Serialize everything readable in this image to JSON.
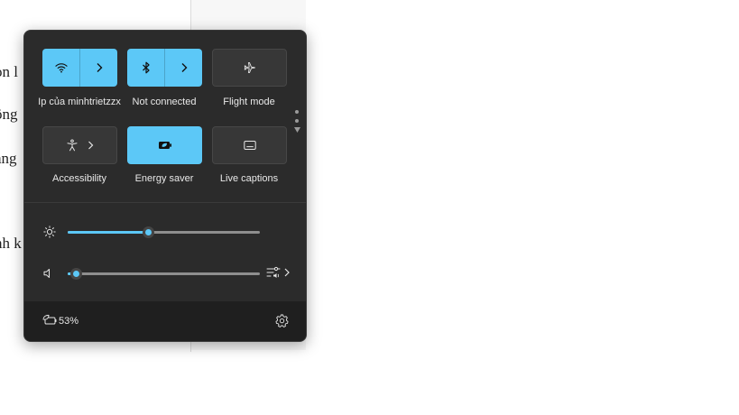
{
  "background_doc": {
    "lines": [
      "on l",
      "ông",
      "ang",
      "nh k"
    ]
  },
  "quick_settings": {
    "tiles": [
      {
        "label": "Ip của minhtrietzzx",
        "icon": "wifi-icon",
        "state": "on",
        "has_chevron": true
      },
      {
        "label": "Not connected",
        "icon": "bluetooth-icon",
        "state": "on",
        "has_chevron": true
      },
      {
        "label": "Flight mode",
        "icon": "airplane-icon",
        "state": "off",
        "has_chevron": false
      },
      {
        "label": "Accessibility",
        "icon": "accessibility-icon",
        "state": "off",
        "has_chevron": true
      },
      {
        "label": "Energy saver",
        "icon": "energy-saver-icon",
        "state": "on",
        "has_chevron": false
      },
      {
        "label": "Live captions",
        "icon": "captions-icon",
        "state": "off",
        "has_chevron": false
      }
    ],
    "brightness": {
      "icon": "brightness-icon",
      "level": 0.42
    },
    "volume": {
      "icon": "speaker-icon",
      "level": 0.04,
      "output_icon": "audio-output-icon"
    }
  },
  "footer": {
    "battery_icon": "battery-saver-icon",
    "battery_percent": "53%",
    "settings_icon": "settings-gear-icon"
  },
  "colors": {
    "accent": "#5cc8f7",
    "panel_bg": "#2b2b2b",
    "footer_bg": "#1f1f1f"
  }
}
